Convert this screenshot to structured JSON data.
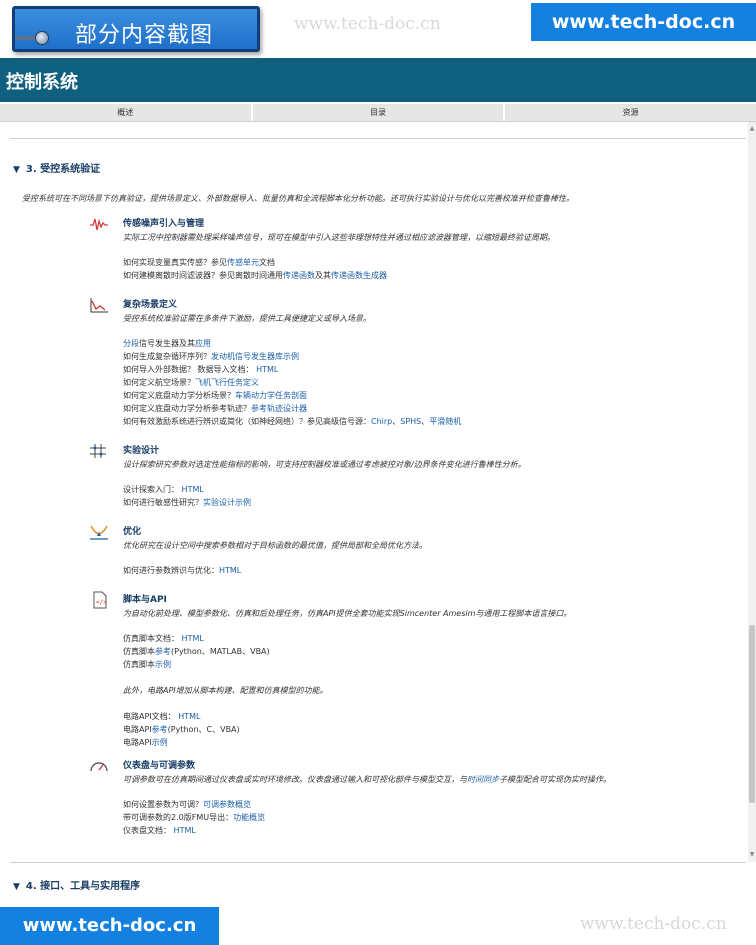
{
  "banner": {
    "label": "部分内容截图",
    "watermark": "www.tech-doc.cn",
    "site": "www.tech-doc.cn"
  },
  "header": {
    "title": "控制系统"
  },
  "nav": {
    "tabs": [
      "概述",
      "目录",
      "资源"
    ]
  },
  "section3": {
    "title": "3. 受控系统验证",
    "intro": "受控系统可在不同场景下仿真验证，提供场景定义、外部数据导入、批量仿真和全流程脚本化分析功能。还可执行实验设计与优化以完善校准并检查鲁棒性。",
    "features": [
      {
        "title": "传感噪声引入与管理",
        "desc": "实际工况中控制器需处理采样噪声信号，现可在模型中引入这些非理想特性并通过相应滤波器管理，以缩短最终验证周期。",
        "lines": [
          {
            "parts": [
              {
                "t": "如何实现变量真实传感？参见"
              },
              {
                "t": "传感单元",
                "link": true
              },
              {
                "t": "文档"
              }
            ]
          },
          {
            "parts": [
              {
                "t": "如何建模离散时间滤波器？参见离散时间通用"
              },
              {
                "t": "传递函数",
                "link": true
              },
              {
                "t": "及其"
              },
              {
                "t": "传递函数生成器",
                "link": true
              }
            ]
          }
        ]
      },
      {
        "title": "复杂场景定义",
        "desc": "受控系统校准验证需在多条件下激励，提供工具便捷定义或导入场景。",
        "lines": [
          {
            "parts": [
              {
                "t": "分段",
                "link": true
              },
              {
                "t": "信号发生器及其"
              },
              {
                "t": "应用",
                "link": true
              }
            ]
          },
          {
            "parts": [
              {
                "t": "如何生成复杂循环序列？"
              },
              {
                "t": "发动机信号发生器库示例",
                "link": true
              }
            ]
          },
          {
            "parts": [
              {
                "t": "如何导入外部数据？ 数据导入文档： "
              },
              {
                "t": "HTML",
                "link": true
              }
            ]
          },
          {
            "parts": [
              {
                "t": "如何定义航空场景？"
              },
              {
                "t": "飞机飞行任务定义",
                "link": true
              }
            ]
          },
          {
            "parts": [
              {
                "t": "如何定义底盘动力学分析场景？"
              },
              {
                "t": "车辆动力学任务剖面",
                "link": true
              }
            ]
          },
          {
            "parts": [
              {
                "t": "如何定义底盘动力学分析参考轨迹？"
              },
              {
                "t": "参考轨迹设计器",
                "link": true
              }
            ]
          },
          {
            "parts": [
              {
                "t": "如何有效激励系统进行辨识或简化（如神经网络）？参见高级信号源："
              },
              {
                "t": "Chirp",
                "link": true
              },
              {
                "t": "、"
              },
              {
                "t": "SPHS",
                "link": true
              },
              {
                "t": "、"
              },
              {
                "t": "平滑随机",
                "link": true
              }
            ]
          }
        ]
      },
      {
        "title": "实验设计",
        "desc": "设计探索研究参数对选定性能指标的影响，可支持控制器校准或通过考虑被控对象/边界条件变化进行鲁棒性分析。",
        "lines": [
          {
            "parts": [
              {
                "t": "设计探索入门： "
              },
              {
                "t": "HTML",
                "link": true
              }
            ]
          },
          {
            "parts": [
              {
                "t": "如何进行敏感性研究？"
              },
              {
                "t": "实验设计示例",
                "link": true
              }
            ]
          }
        ]
      },
      {
        "title": "优化",
        "desc": "优化研究在设计空间中搜索参数相对于目标函数的最优值，提供局部和全局优化方法。",
        "lines": [
          {
            "parts": [
              {
                "t": "如何进行参数辨识与优化："
              },
              {
                "t": "HTML",
                "link": true
              }
            ]
          }
        ]
      },
      {
        "title": "脚本与API",
        "desc": "为自动化前处理、模型参数化、仿真和后处理任务，仿真API提供全套功能实现Simcenter Amesim与通用工程脚本语言接口。",
        "lines": [
          {
            "parts": [
              {
                "t": "仿真脚本文档： "
              },
              {
                "t": "HTML",
                "link": true
              }
            ]
          },
          {
            "parts": [
              {
                "t": "仿真脚本"
              },
              {
                "t": "参考",
                "link": true
              },
              {
                "t": "(Python、MATLAB、VBA)"
              }
            ]
          },
          {
            "parts": [
              {
                "t": "仿真脚本"
              },
              {
                "t": "示例",
                "link": true
              }
            ]
          },
          {
            "parts": [
              {
                "t": ""
              }
            ]
          },
          {
            "parts": [
              {
                "t": "此外，电路API增加从脚本构建、配置和仿真模型的功能。"
              }
            ],
            "italic": true
          },
          {
            "parts": [
              {
                "t": ""
              }
            ]
          },
          {
            "parts": [
              {
                "t": "电路API文档： "
              },
              {
                "t": "HTML",
                "link": true
              }
            ]
          },
          {
            "parts": [
              {
                "t": "电路API"
              },
              {
                "t": "参考",
                "link": true
              },
              {
                "t": "(Python、C、VBA)"
              }
            ]
          },
          {
            "parts": [
              {
                "t": "电路API"
              },
              {
                "t": "示例",
                "link": true
              }
            ]
          }
        ]
      },
      {
        "title": "仪表盘与可调参数",
        "desc": "可调参数可在仿真期间通过仪表盘或实时环境修改。仪表盘通过输入和可视化部件与模型交互，与时间同步子模型配合可实现伪实时操作。",
        "desc_parts": [
          {
            "t": "可调参数可在仿真期间通过仪表盘或实时环境修改。仪表盘通过输入和可视化部件与模型交互，与"
          },
          {
            "t": "时间同步",
            "link": true
          },
          {
            "t": "子模型配合可实现伪实时操作。"
          }
        ],
        "lines": [
          {
            "parts": [
              {
                "t": "如何设置参数为可调？"
              },
              {
                "t": "可调参数概览",
                "link": true
              }
            ]
          },
          {
            "parts": [
              {
                "t": "带可调参数的2.0版FMU导出："
              },
              {
                "t": "功能概览",
                "link": true
              }
            ]
          },
          {
            "parts": [
              {
                "t": "仪表盘文档： "
              },
              {
                "t": "HTML",
                "link": true
              }
            ]
          }
        ]
      }
    ]
  },
  "section4": {
    "title": "4. 接口、工具与实用程序"
  },
  "footer": {
    "site": "www.tech-doc.cn",
    "watermark": "www.tech-doc.cn"
  },
  "icons": {
    "f0": "sensor-noise-icon",
    "f1": "scenario-chart-icon",
    "f2": "grid-design-icon",
    "f3": "optimization-icon",
    "f4": "script-file-icon",
    "f5": "dashboard-gauge-icon"
  },
  "colors": {
    "header": "#0f5f7e",
    "link": "#1c5fa8",
    "banner": "#1480e0"
  }
}
